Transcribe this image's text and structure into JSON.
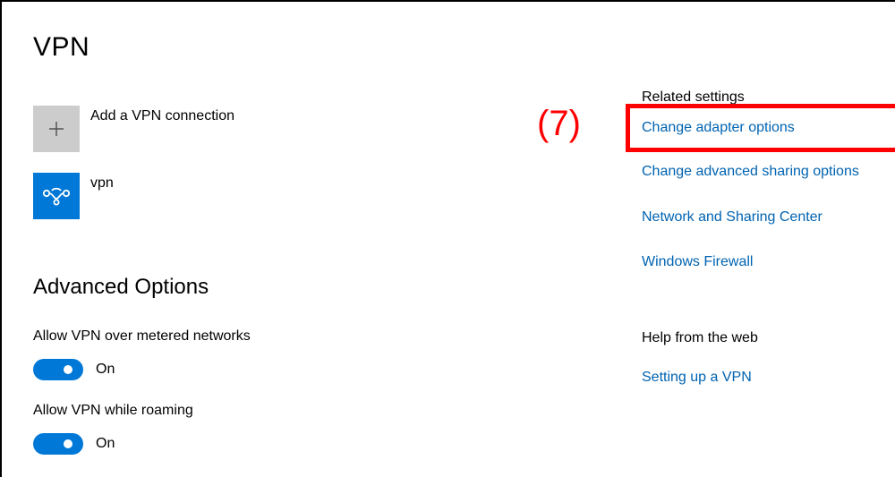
{
  "page": {
    "title": "VPN"
  },
  "connections": {
    "add": {
      "label": "Add a VPN connection",
      "icon": "plus-icon"
    },
    "items": [
      {
        "label": "vpn",
        "icon": "vpn-icon"
      }
    ]
  },
  "advanced": {
    "title": "Advanced Options",
    "metered": {
      "label": "Allow VPN over metered networks",
      "state": "On",
      "enabled": true
    },
    "roaming": {
      "label": "Allow VPN while roaming",
      "state": "On",
      "enabled": true
    }
  },
  "related": {
    "heading": "Related settings",
    "links": [
      "Change adapter options",
      "Change advanced sharing options",
      "Network and Sharing Center",
      "Windows Firewall"
    ]
  },
  "help": {
    "heading": "Help from the web",
    "links": [
      "Setting up a VPN"
    ]
  },
  "annotation": {
    "label": "(7)",
    "color": "#ff0000"
  },
  "colors": {
    "accent": "#0078d7",
    "link": "#0063b1",
    "tile_gray": "#cccccc"
  }
}
